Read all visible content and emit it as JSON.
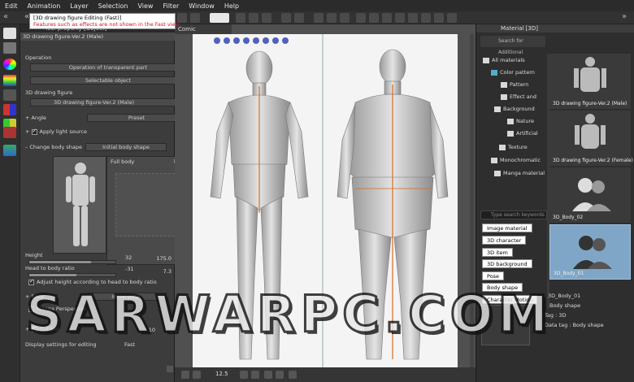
{
  "menubar": [
    "Edit",
    "Animation",
    "Layer",
    "Selection",
    "View",
    "Filter",
    "Window",
    "Help"
  ],
  "tool_property": {
    "title": "Tool property [Object]",
    "subtitle": "3D drawing figure-Ver.2 (Male)",
    "popup_line1": "[3D drawing figure Editing (Fast)]",
    "popup_line2": "Features such as effects are not shown in the Fast view",
    "operation_label": "Operation",
    "operation_value": "Operation of transparent part",
    "selectable_value": "Selectable object",
    "figure_label": "3D drawing figure",
    "figure_value": "3D drawing figure-Ver.2 (Male)",
    "angle_label": "Angle",
    "preset_label": "Preset",
    "light_label": "Apply light source",
    "change_body_label": "Change body shape",
    "initial_body_label": "Initial body shape",
    "full_body_label": "Full body",
    "val_a": "32",
    "val_b": "-31",
    "height_label": "Height",
    "height_value": "175.0",
    "head_ratio_label": "Head to body ratio",
    "head_ratio_value": "7.3",
    "adjust_label": "Adjust height according to head to body ratio",
    "pose_label": "Pose",
    "initial_pose_label": "Initial pose",
    "manga_label": "Manga Perspective",
    "outline_label": "Outline",
    "outline_value": "10",
    "display_label": "Display settings for editing",
    "display_value": "Fast",
    "height_fraction": 0.72,
    "head_ratio_fraction": 0.55
  },
  "canvas": {
    "tab_label": "Comic",
    "zoom": "12.5"
  },
  "material": {
    "title": "Material [3D]",
    "search_placeholder": "Search for Additional",
    "tree": [
      "All materials",
      "Color pattern",
      "Pattern",
      "Effect and",
      "Background",
      "Nature",
      "Artificial",
      "Texture",
      "Monochromatic",
      "Manga material"
    ],
    "tag_search_placeholder": "Type search keywords",
    "tags": [
      "Image material",
      "3D character",
      "3D item",
      "3D background",
      "Pose",
      "Body shape",
      "Character Motion"
    ],
    "thumbs": [
      "3D drawing figure-Ver.2 (Male)",
      "3D drawing figure-Ver.2 (Female)",
      "3D_Body_02",
      "3D_Body_01"
    ],
    "info_name": "3D_Body_01",
    "info_type": "Body shape",
    "info_tag": "Tag : 3D",
    "info_data": "Data tag : Body shape"
  },
  "watermark": "SARWARPC.COM"
}
